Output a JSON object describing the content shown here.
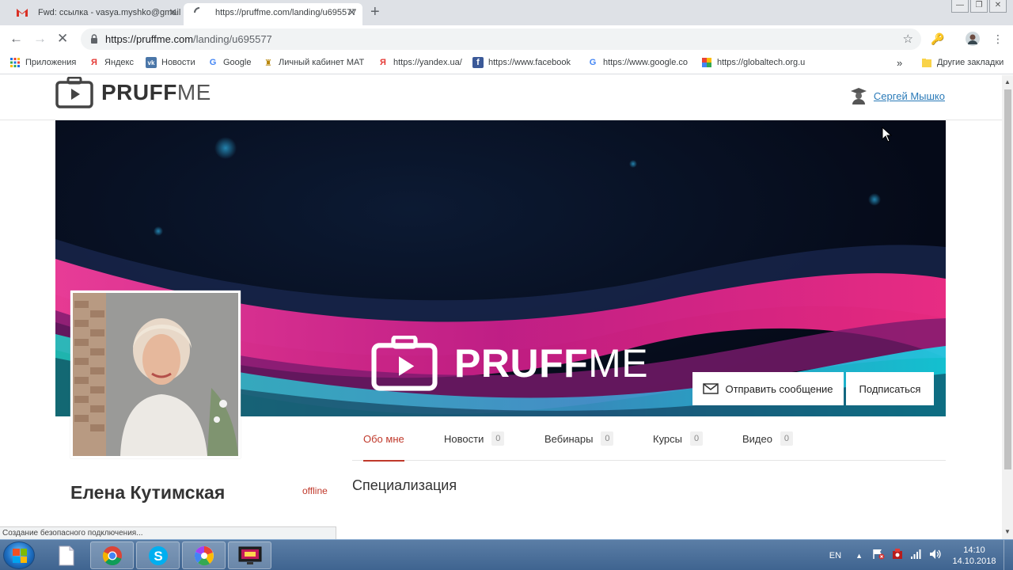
{
  "browser": {
    "tabs": [
      {
        "title": "Fwd: ссылка - vasya.myshko@gmail",
        "favicon": "gmail-icon",
        "active": false
      },
      {
        "title": "https://pruffme.com/landing/u695577",
        "favicon": "loading-spinner-icon",
        "active": true
      }
    ],
    "new_tab": "+",
    "url_host": "https://pruffme.com",
    "url_path": "/landing/u695577",
    "bookmarks": [
      {
        "label": "Приложения",
        "icon": "apps-grid-icon"
      },
      {
        "label": "Яндекс",
        "icon": "yandex-icon"
      },
      {
        "label": "Новости",
        "icon": "vk-icon"
      },
      {
        "label": "Google",
        "icon": "google-icon"
      },
      {
        "label": "Личный кабинет МАТ",
        "icon": "cabinet-icon"
      },
      {
        "label": "https://yandex.ua/",
        "icon": "yandex-icon"
      },
      {
        "label": "https://www.facebook",
        "icon": "facebook-icon"
      },
      {
        "label": "https://www.google.co",
        "icon": "google-icon"
      },
      {
        "label": "https://globaltech.org.u",
        "icon": "globaltech-icon"
      }
    ],
    "overflow": "»",
    "other_bookmarks": "Другие закладки",
    "status_text": "Создание безопасного подключения..."
  },
  "site": {
    "logo_bold": "PRUFF",
    "logo_light": "ME",
    "user_name": "Сергей Мышко"
  },
  "profile": {
    "cover_logo_bold": "PRUFF",
    "cover_logo_light": "ME",
    "send_message": "Отправить сообщение",
    "subscribe": "Подписаться",
    "name": "Елена Кутимская",
    "status": "offline",
    "tabs": [
      {
        "label": "Обо мне",
        "count": null
      },
      {
        "label": "Новости",
        "count": "0"
      },
      {
        "label": "Вебинары",
        "count": "0"
      },
      {
        "label": "Курсы",
        "count": "0"
      },
      {
        "label": "Видео",
        "count": "0"
      }
    ],
    "section_title": "Специализация"
  },
  "taskbar": {
    "apps": [
      "file-icon",
      "chrome-icon",
      "skype-icon",
      "picasa-icon",
      "monitor-app-icon"
    ],
    "language": "EN",
    "time": "14:10",
    "date": "14.10.2018"
  },
  "colors": {
    "accent": "#c0392b",
    "link": "#2a7ab8",
    "taskbar": "#4a6f99"
  }
}
